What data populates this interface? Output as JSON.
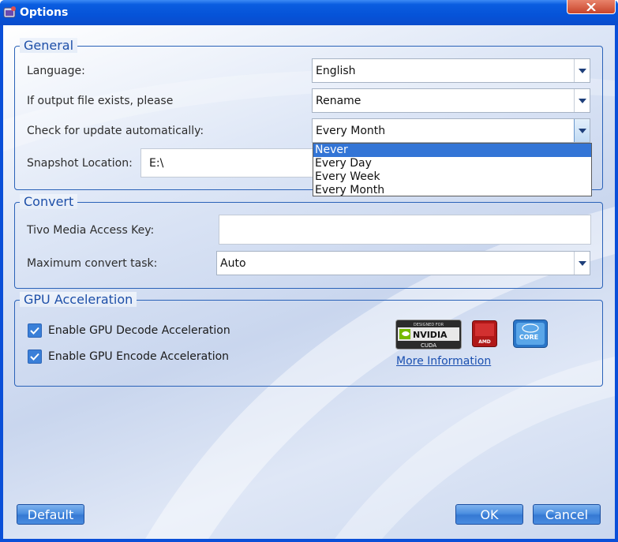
{
  "window": {
    "title": "Options"
  },
  "general": {
    "legend": "General",
    "language_label": "Language:",
    "language_value": "English",
    "output_exists_label": "If output file exists, please",
    "output_exists_value": "Rename",
    "update_label": "Check for update automatically:",
    "update_value": "Every Month",
    "update_options": [
      "Never",
      "Every Day",
      "Every Week",
      "Every Month"
    ],
    "update_highlighted": "Never",
    "snapshot_label": "Snapshot Location:",
    "snapshot_value": "E:\\"
  },
  "convert": {
    "legend": "Convert",
    "tivo_label": "Tivo Media Access Key:",
    "tivo_value": "",
    "max_task_label": "Maximum convert task:",
    "max_task_value": "Auto"
  },
  "gpu": {
    "legend": "GPU Acceleration",
    "decode_label": "Enable GPU Decode Acceleration",
    "decode_checked": true,
    "encode_label": "Enable GPU Encode Acceleration",
    "encode_checked": true,
    "logos": [
      "nvidia-cuda-logo",
      "amd-logo",
      "intel-core-logo"
    ],
    "more_info_link": "More Information"
  },
  "buttons": {
    "default": "Default",
    "ok": "OK",
    "cancel": "Cancel"
  },
  "colors": {
    "title_bar": "#0653d8",
    "group_border": "#2a62b8",
    "legend_text": "#1d4fa8",
    "button": "#3579d3",
    "selection": "#3375d6"
  }
}
